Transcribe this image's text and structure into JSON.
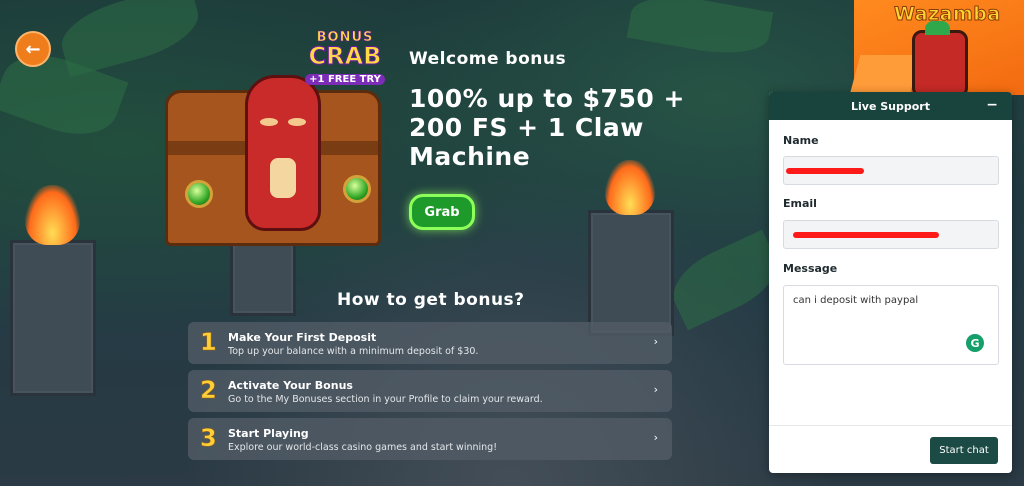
{
  "back_button": {
    "icon": "arrow-left-icon"
  },
  "promo": {
    "logo_line1": "BONUS",
    "logo_line2": "CRAB",
    "logo_line3": "+1 FREE TRY",
    "welcome": "Welcome bonus",
    "headline": "100% up to $750 + 200 FS + 1 Claw Machine",
    "grab_label": "Grab"
  },
  "how_to": {
    "title": "How to get bonus?",
    "steps": [
      {
        "num": "1",
        "title": "Make Your First Deposit",
        "desc": "Top up your balance with a minimum deposit of $30."
      },
      {
        "num": "2",
        "title": "Activate Your Bonus",
        "desc": "Go to the My Bonuses section in your Profile to claim your reward."
      },
      {
        "num": "3",
        "title": "Start Playing",
        "desc": "Explore our world-class casino games and start winning!"
      }
    ]
  },
  "brand": {
    "name": "Wazamba"
  },
  "chat": {
    "title": "Live Support",
    "minimize": "−",
    "name_label": "Name",
    "email_label": "Email",
    "message_label": "Message",
    "message_value": "can i deposit with paypal",
    "grammarly_glyph": "G",
    "start_label": "Start chat"
  },
  "colors": {
    "accent_orange": "#f07d1c",
    "grab_green": "#1e9a2a",
    "chat_header": "#19433d",
    "redaction": "#ff1a1a"
  }
}
